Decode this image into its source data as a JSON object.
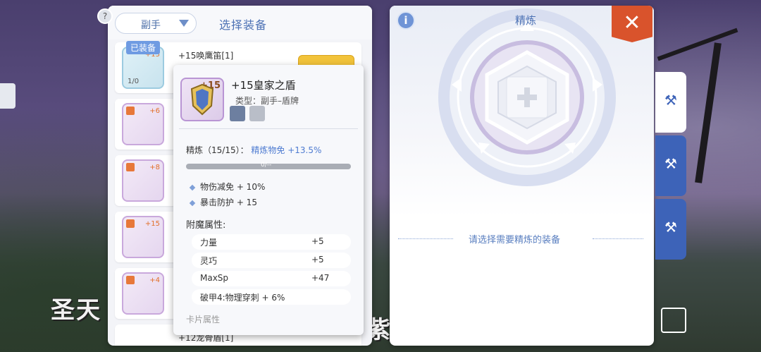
{
  "equip_panel": {
    "slot_select": "副手",
    "title": "选择装备",
    "equipped_badge": "已装备",
    "first_item_name": "+15唤鹰笛[1]",
    "first_item_plus": "+15",
    "first_item_count": "1/0",
    "items": [
      {
        "plus": "+6"
      },
      {
        "plus": "+8"
      },
      {
        "plus": "+15"
      },
      {
        "plus": "+4"
      }
    ],
    "last_item_name": "+12龙骨盾[1]"
  },
  "tooltip": {
    "plus": "+15",
    "name": "+15皇家之盾",
    "type": "类型：副手–盾牌",
    "refine_label": "精炼（15/15）：",
    "refine_value": "精炼物免 +13.5%",
    "bar_text": "0/--",
    "stats": [
      "物伤减免 + 10%",
      "暴击防护 + 15"
    ],
    "enchant_title": "附魔属性:",
    "enchants": [
      {
        "name": "力量",
        "value": "+5"
      },
      {
        "name": "灵巧",
        "value": "+5"
      },
      {
        "name": "MaxSp",
        "value": "+47"
      },
      {
        "name": "破甲4:物理穿刺 + 6%",
        "value": ""
      }
    ],
    "more": "卡片属性"
  },
  "refine_panel": {
    "info": "i",
    "title": "精炼",
    "close": "✕",
    "hint": "请选择需要精炼的装备"
  },
  "side_tabs": [
    "refine-hammer-icon",
    "transfer-hammer-icon",
    "upgrade-hammer-icon"
  ],
  "caption": "圣天",
  "caption_right": "紫",
  "colors": {
    "accent": "#4d72b5",
    "close": "#d9532c",
    "tab": "#3d63b8",
    "highlight": "#4e7bd1"
  }
}
